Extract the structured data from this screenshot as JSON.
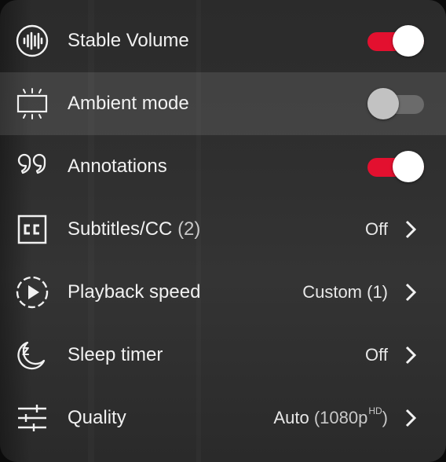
{
  "settings_menu": {
    "items": [
      {
        "label": "Stable Volume",
        "icon": "stable-volume-icon",
        "control": "toggle",
        "on": true
      },
      {
        "label": "Ambient mode",
        "icon": "ambient-mode-icon",
        "control": "toggle",
        "on": false
      },
      {
        "label": "Annotations",
        "icon": "annotations-icon",
        "control": "toggle",
        "on": true
      },
      {
        "label": "Subtitles/CC",
        "count": "(2)",
        "icon": "closed-captions-icon",
        "control": "submenu",
        "value": "Off"
      },
      {
        "label": "Playback speed",
        "icon": "playback-speed-icon",
        "control": "submenu",
        "value": "Custom (1)"
      },
      {
        "label": "Sleep timer",
        "icon": "sleep-timer-icon",
        "control": "submenu",
        "value": "Off"
      },
      {
        "label": "Quality",
        "icon": "quality-sliders-icon",
        "control": "submenu",
        "value": "Auto",
        "value_detail": "(1080p",
        "value_badge": "HD",
        "value_close": ")"
      }
    ]
  },
  "colors": {
    "accent": "#e3102f",
    "text": "#f1f1f1",
    "panel": "#2f2f2f"
  }
}
